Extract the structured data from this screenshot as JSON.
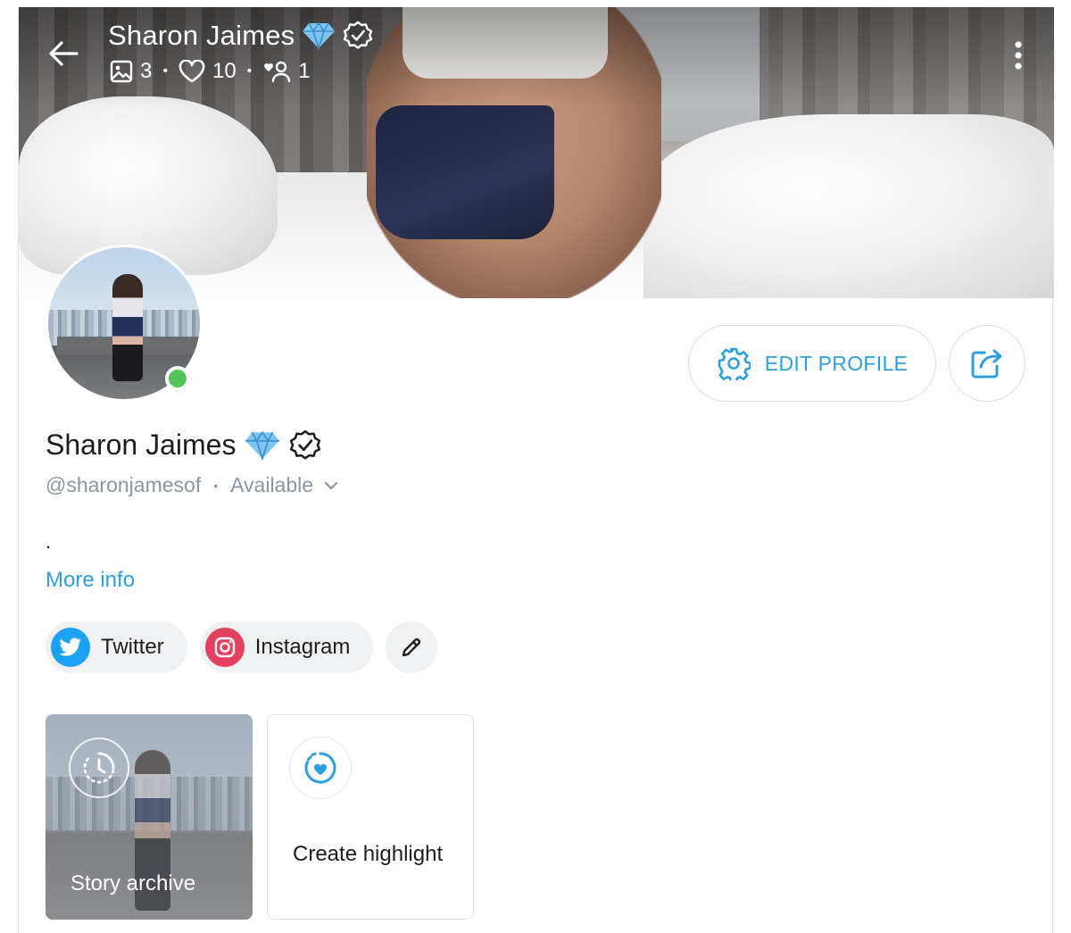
{
  "cover": {
    "name": "Sharon Jaimes",
    "stats": {
      "posts": "3",
      "likes": "10",
      "fans": "1"
    }
  },
  "profile": {
    "name": "Sharon Jaimes",
    "handle": "@sharonjamesof",
    "status": "Available",
    "bio": ".",
    "more_info": "More info"
  },
  "actions": {
    "edit_profile": "EDIT PROFILE"
  },
  "socials": [
    {
      "label": "Twitter",
      "icon": "twitter-icon"
    },
    {
      "label": "Instagram",
      "icon": "instagram-icon"
    }
  ],
  "highlights": {
    "archive_label": "Story archive",
    "create_label": "Create highlight"
  },
  "colors": {
    "accent": "#2d9ee0",
    "online": "#55c35a",
    "muted": "#8a96a3",
    "twitter": "#1da1f2",
    "instagram": "#e4405f"
  }
}
